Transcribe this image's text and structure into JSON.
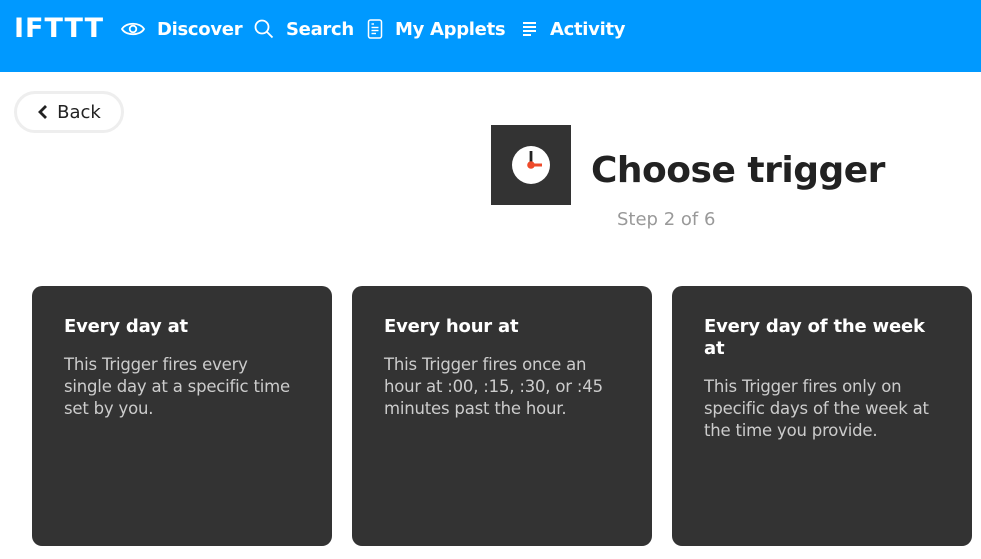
{
  "header": {
    "logo": "IFTTT",
    "nav": [
      {
        "label": "Discover",
        "icon": "eye-icon"
      },
      {
        "label": "Search",
        "icon": "search-icon"
      },
      {
        "label": "My Applets",
        "icon": "document-icon"
      },
      {
        "label": "Activity",
        "icon": "list-icon"
      }
    ],
    "brand_color": "#0099ff"
  },
  "back": {
    "label": "Back"
  },
  "page": {
    "service_icon": "clock-icon",
    "title": "Choose trigger",
    "step": "Step 2 of 6"
  },
  "triggers": [
    {
      "title": "Every day at",
      "description": "This Trigger fires every single day at a specific time set by you."
    },
    {
      "title": "Every hour at",
      "description": "This Trigger fires once an hour at :00, :15, :30, or :45 minutes past the hour."
    },
    {
      "title": "Every day of the week at",
      "description": "This Trigger fires only on specific days of the week at the time you provide."
    }
  ]
}
